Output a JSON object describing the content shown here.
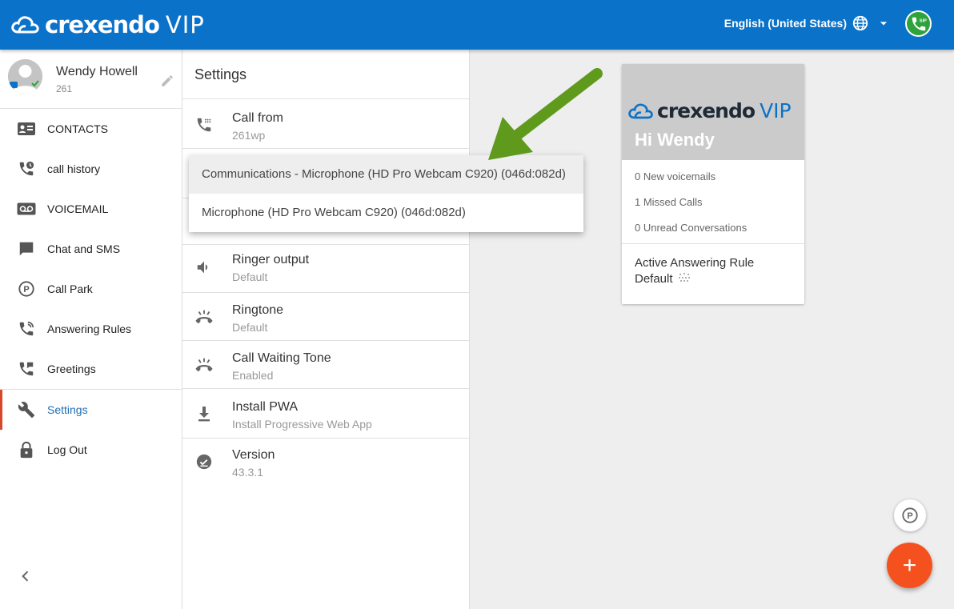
{
  "header": {
    "logo_text": "crexendo",
    "logo_vip": "VIP",
    "language": "English (United States)",
    "sip_badge": "SIP",
    "colors": {
      "bar": "#0a73c9",
      "sip": "#2fa33b"
    }
  },
  "profile": {
    "name": "Wendy Howell",
    "extension": "261"
  },
  "sidebar": {
    "items": [
      {
        "label": "CONTACTS",
        "icon": "contacts-icon"
      },
      {
        "label": "call history",
        "icon": "call-history-icon"
      },
      {
        "label": "VOICEMAIL",
        "icon": "voicemail-icon"
      },
      {
        "label": "Chat and SMS",
        "icon": "chat-icon"
      },
      {
        "label": "Call Park",
        "icon": "park-icon"
      },
      {
        "label": "Answering Rules",
        "icon": "answering-rules-icon"
      },
      {
        "label": "Greetings",
        "icon": "greetings-icon"
      },
      {
        "label": "Settings",
        "icon": "wrench-icon",
        "active": true
      },
      {
        "label": "Log Out",
        "icon": "lock-icon"
      }
    ]
  },
  "settings": {
    "title": "Settings",
    "items": [
      {
        "label": "Call from",
        "sub": "261wp",
        "icon": "phone-dial-icon"
      },
      {
        "label": "Ringer output",
        "sub": "Default",
        "icon": "speaker-icon"
      },
      {
        "label": "Ringtone",
        "sub": "Default",
        "icon": "ringing-phone-icon"
      },
      {
        "label": "Call Waiting Tone",
        "sub": "Enabled",
        "icon": "ringing-phone-icon"
      },
      {
        "label": "Install PWA",
        "sub": "Install Progressive Web App",
        "icon": "download-icon"
      },
      {
        "label": "Version",
        "sub": "43.3.1",
        "icon": "check-circle-icon"
      }
    ]
  },
  "dropdown": {
    "options": [
      "Communications - Microphone (HD Pro Webcam C920) (046d:082d)",
      "Microphone (HD Pro Webcam C920) (046d:082d)"
    ],
    "highlighted_index": 0
  },
  "card": {
    "logo_text": "crexendo",
    "logo_vip": "VIP",
    "greeting": "Hi Wendy",
    "stats": [
      "0 New voicemails",
      "1 Missed Calls",
      "0 Unread Conversations"
    ],
    "rule_title": "Active Answering Rule",
    "rule_value": "Default"
  },
  "fab": {
    "add_label": "+"
  },
  "annotation": {
    "arrow_color": "#5f9a1d"
  }
}
